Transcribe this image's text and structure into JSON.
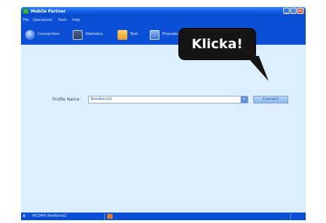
{
  "window": {
    "title": "Mobile Partner",
    "controls": {
      "minimize": "_",
      "maximize": "□",
      "close": "×"
    }
  },
  "menu": {
    "items": [
      "File",
      "Operations",
      "Tools",
      "Help"
    ]
  },
  "toolbar": {
    "items": [
      {
        "label": "Connection",
        "icon": "globe-icon",
        "color": "#5a8fe6"
      },
      {
        "label": "Statistics",
        "icon": "stats-icon",
        "color": "#3a78d4"
      },
      {
        "label": "Text",
        "icon": "envelope-icon",
        "color": "#f3b63b"
      },
      {
        "label": "Phonebook",
        "icon": "phonebook-icon",
        "color": "#5a8fe6"
      }
    ]
  },
  "connection": {
    "profile_label": "Profile Name:",
    "profile_value": "Bredband2",
    "dropdown_arrow": "▾",
    "connect_label": "Connect"
  },
  "statusbar": {
    "left_text": "WCDMA Bredband2",
    "signal_icon": "signal-icon",
    "status_icon": "messages-icon"
  },
  "callout": {
    "text": "Klicka!"
  },
  "colors": {
    "window_blue": "#0a4fd6",
    "content_bg": "#ddeefc",
    "callout_bg": "#151515"
  }
}
